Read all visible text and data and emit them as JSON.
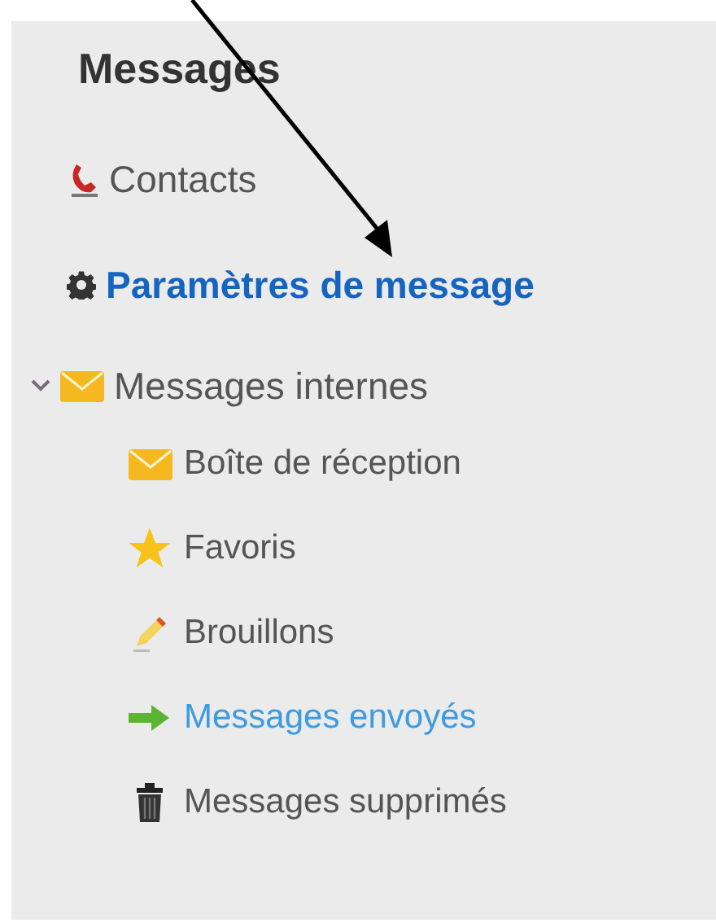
{
  "heading": "Messages",
  "items": [
    {
      "label": "Contacts",
      "kind": "phone",
      "selected": false
    },
    {
      "label": "Paramètres de message",
      "kind": "gear",
      "selected": true
    }
  ],
  "folder": {
    "label": "Messages internes",
    "kind": "envelope",
    "expanded": true,
    "children": [
      {
        "label": "Boîte de réception",
        "kind": "envelope",
        "hovered": false
      },
      {
        "label": "Favoris",
        "kind": "star",
        "hovered": false
      },
      {
        "label": "Brouillons",
        "kind": "pencil",
        "hovered": false
      },
      {
        "label": "Messages envoyés",
        "kind": "arrow",
        "hovered": true
      },
      {
        "label": "Messages supprimés",
        "kind": "trash",
        "hovered": false
      }
    ]
  }
}
